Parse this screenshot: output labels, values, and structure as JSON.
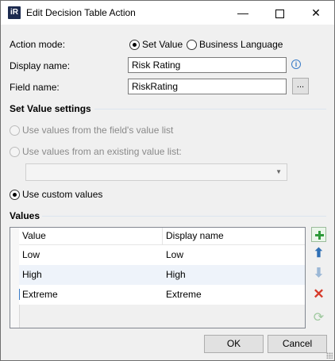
{
  "window": {
    "title": "Edit Decision Table Action",
    "icon_text": "iR"
  },
  "titlebar": {
    "min_glyph": "—",
    "close_glyph": "✕"
  },
  "form": {
    "action_mode_label": "Action mode:",
    "mode_options": [
      {
        "label": "Set Value",
        "selected": true
      },
      {
        "label": "Business Language",
        "selected": false
      }
    ],
    "display_name_label": "Display name:",
    "display_name_value": "Risk Rating",
    "field_name_label": "Field name:",
    "field_name_value": "RiskRating",
    "browse_label": "...",
    "info_glyph": "i"
  },
  "set_value_settings": {
    "heading": "Set Value settings",
    "options": [
      {
        "label": "Use values from the field's value list",
        "enabled": false,
        "selected": false
      },
      {
        "label": "Use values from an existing value list:",
        "enabled": false,
        "selected": false
      },
      {
        "label": "Use custom values",
        "enabled": true,
        "selected": true
      }
    ],
    "value_list_selected": "",
    "combo_arrow": "▼"
  },
  "values": {
    "heading": "Values",
    "columns": [
      "Value",
      "Display name"
    ],
    "rows": [
      {
        "value": "Low",
        "display": "Low"
      },
      {
        "value": "High",
        "display": "High"
      },
      {
        "value": "Extreme",
        "display": "Extreme"
      }
    ],
    "tool_buttons": [
      {
        "icon": "add-icon"
      },
      {
        "icon": "arrow-up-icon",
        "glyph": "⬆"
      },
      {
        "icon": "arrow-down-icon",
        "glyph": "⬇"
      },
      {
        "icon": "delete-icon",
        "glyph": "✕"
      },
      {
        "icon": "refresh-icon",
        "glyph": "⟳"
      }
    ]
  },
  "footer": {
    "ok_label": "OK",
    "cancel_label": "Cancel"
  },
  "colors": {
    "accent": "#3a7cc7",
    "add": "#2e9a3a",
    "delete": "#d63a2a",
    "selected_row": "#eef3fa"
  }
}
